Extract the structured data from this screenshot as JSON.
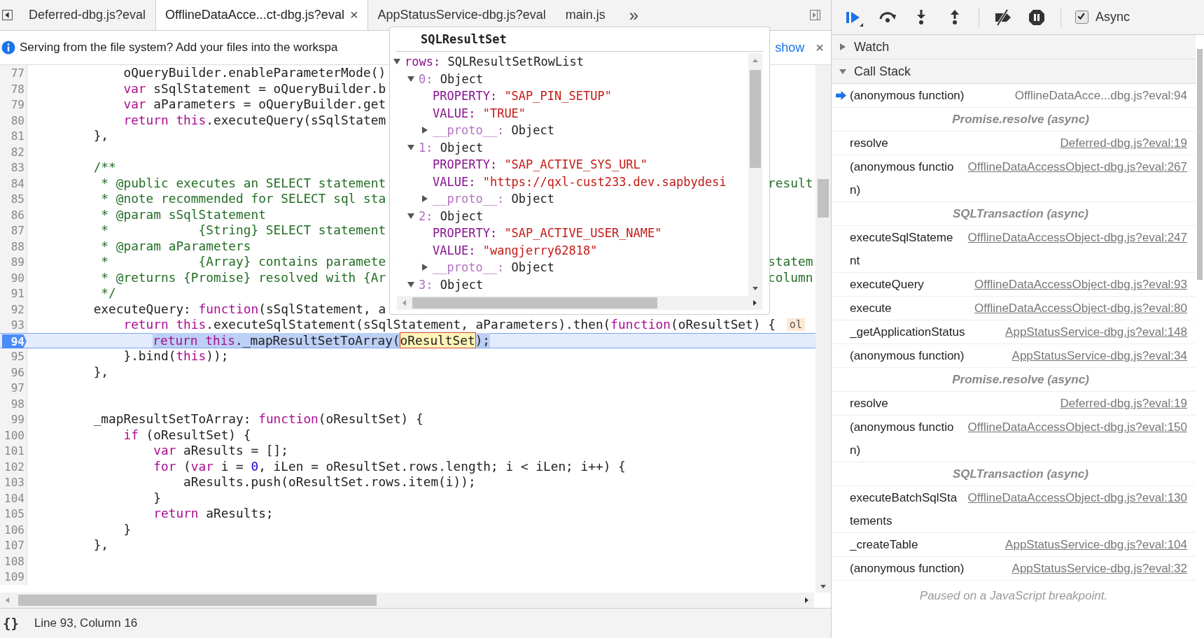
{
  "tabs": {
    "items": [
      {
        "label": "Deferred-dbg.js?eval",
        "selected": false
      },
      {
        "label": "OfflineDataAcce...ct-dbg.js?eval",
        "selected": true,
        "close": "×"
      },
      {
        "label": "AppStatusService-dbg.js?eval",
        "selected": false
      },
      {
        "label": "main.js",
        "selected": false
      }
    ],
    "overflow": "»"
  },
  "infobar": {
    "message": "Serving from the file system? Add your files into the workspa",
    "link": "show",
    "close": "×"
  },
  "editor": {
    "lines": [
      {
        "number": "77",
        "current": false,
        "tokens": [
          {
            "text": "            oQueryBuilder.enableParameterMode()",
            "kind": "plain"
          }
        ]
      },
      {
        "number": "78",
        "current": false,
        "tokens": [
          {
            "text": "            var",
            "kind": "keyword"
          },
          {
            "text": " sSqlStatement = oQueryBuilder.b",
            "kind": "plain"
          }
        ]
      },
      {
        "number": "79",
        "current": false,
        "tokens": [
          {
            "text": "            var",
            "kind": "keyword"
          },
          {
            "text": " aParameters = oQueryBuilder.get",
            "kind": "plain"
          }
        ]
      },
      {
        "number": "80",
        "current": false,
        "tokens": [
          {
            "text": "            return this",
            "kind": "keyword"
          },
          {
            "text": ".executeQuery(sSqlStatem",
            "kind": "plain"
          }
        ]
      },
      {
        "number": "81",
        "current": false,
        "tokens": [
          {
            "text": "        },",
            "kind": "plain"
          }
        ]
      },
      {
        "number": "82",
        "current": false
      },
      {
        "number": "83",
        "current": false,
        "tokens": [
          {
            "text": "        /**",
            "kind": "comment"
          }
        ]
      },
      {
        "number": "84",
        "current": false,
        "tokens": [
          {
            "text": "         * @public executes an SELECT statement",
            "kind": "comment"
          }
        ],
        "right": [
          {
            "text": "result",
            "kind": "comment"
          }
        ]
      },
      {
        "number": "85",
        "current": false,
        "tokens": [
          {
            "text": "         * @note recommended for SELECT sql sta",
            "kind": "comment"
          }
        ]
      },
      {
        "number": "86",
        "current": false,
        "tokens": [
          {
            "text": "         * @param sSqlStatement",
            "kind": "comment"
          }
        ]
      },
      {
        "number": "87",
        "current": false,
        "tokens": [
          {
            "text": "         *            {String} SELECT statement",
            "kind": "comment"
          }
        ]
      },
      {
        "number": "88",
        "current": false,
        "tokens": [
          {
            "text": "         * @param aParameters",
            "kind": "comment"
          }
        ]
      },
      {
        "number": "89",
        "current": false,
        "tokens": [
          {
            "text": "         *            {Array} contains paramete",
            "kind": "comment"
          }
        ],
        "right": [
          {
            "text": "statem",
            "kind": "comment"
          }
        ]
      },
      {
        "number": "90",
        "current": false,
        "tokens": [
          {
            "text": "         * @returns {Promise} resolved with {Ar",
            "kind": "comment"
          }
        ],
        "right": [
          {
            "text": "column",
            "kind": "comment"
          }
        ]
      },
      {
        "number": "91",
        "current": false,
        "tokens": [
          {
            "text": "         */",
            "kind": "comment"
          }
        ]
      },
      {
        "number": "92",
        "current": false,
        "tokens": [
          {
            "text": "        executeQuery: ",
            "kind": "plain"
          },
          {
            "text": "function",
            "kind": "keyword"
          },
          {
            "text": "(sSqlStatement, a",
            "kind": "plain"
          }
        ]
      },
      {
        "number": "93",
        "current": false,
        "tokens": [
          {
            "text": "            return this",
            "kind": "keyword"
          },
          {
            "text": ".executeSqlStatement(sSqlStatement, aParameters).then(",
            "kind": "plain"
          },
          {
            "text": "function",
            "kind": "keyword"
          },
          {
            "text": "(oResultSet) {",
            "kind": "plain"
          }
        ],
        "hint": "ol"
      },
      {
        "number": "94",
        "current": true,
        "selection": [
          {
            "text": "                return this",
            "kind": "keyword"
          },
          {
            "text": "._mapResultSetToArray(",
            "kind": "plain"
          },
          {
            "text": "oResultSet",
            "kind": "highlight"
          },
          {
            "text": ");",
            "kind": "plain"
          }
        ]
      },
      {
        "number": "95",
        "current": false,
        "tokens": [
          {
            "text": "            }.bind(",
            "kind": "plain"
          },
          {
            "text": "this",
            "kind": "keyword"
          },
          {
            "text": "));",
            "kind": "plain"
          }
        ]
      },
      {
        "number": "96",
        "current": false,
        "tokens": [
          {
            "text": "        },",
            "kind": "plain"
          }
        ]
      },
      {
        "number": "97",
        "current": false
      },
      {
        "number": "98",
        "current": false
      },
      {
        "number": "99",
        "current": false,
        "tokens": [
          {
            "text": "        _mapResultSetToArray: ",
            "kind": "plain"
          },
          {
            "text": "function",
            "kind": "keyword"
          },
          {
            "text": "(oResultSet) {",
            "kind": "plain"
          }
        ]
      },
      {
        "number": "100",
        "current": false,
        "tokens": [
          {
            "text": "            if",
            "kind": "keyword"
          },
          {
            "text": " (oResultSet) {",
            "kind": "plain"
          }
        ]
      },
      {
        "number": "101",
        "current": false,
        "tokens": [
          {
            "text": "                var",
            "kind": "keyword"
          },
          {
            "text": " aResults = [];",
            "kind": "plain"
          }
        ]
      },
      {
        "number": "102",
        "current": false,
        "tokens": [
          {
            "text": "                for",
            "kind": "keyword"
          },
          {
            "text": " (",
            "kind": "plain"
          },
          {
            "text": "var",
            "kind": "keyword"
          },
          {
            "text": " i = ",
            "kind": "plain"
          },
          {
            "text": "0",
            "kind": "number"
          },
          {
            "text": ", iLen = oResultSet.rows.length; i < iLen; i++) {",
            "kind": "plain"
          }
        ]
      },
      {
        "number": "103",
        "current": false,
        "tokens": [
          {
            "text": "                    aResults.push(oResultSet.rows.item(i));",
            "kind": "plain"
          }
        ]
      },
      {
        "number": "104",
        "current": false,
        "tokens": [
          {
            "text": "                }",
            "kind": "plain"
          }
        ]
      },
      {
        "number": "105",
        "current": false,
        "tokens": [
          {
            "text": "                return",
            "kind": "keyword"
          },
          {
            "text": " aResults;",
            "kind": "plain"
          }
        ]
      },
      {
        "number": "106",
        "current": false,
        "tokens": [
          {
            "text": "            }",
            "kind": "plain"
          }
        ]
      },
      {
        "number": "107",
        "current": false,
        "tokens": [
          {
            "text": "        },",
            "kind": "plain"
          }
        ]
      },
      {
        "number": "108",
        "current": false
      },
      {
        "number": "109",
        "current": false
      }
    ]
  },
  "popover": {
    "title": "SQLResultSet",
    "tree": [
      {
        "key": {
          "text": "rows:",
          "kind": "property"
        },
        "value": {
          "text": "SQLResultSetRowList",
          "kind": "object"
        },
        "expanded": true,
        "children": [
          {
            "key": {
              "text": "0:",
              "kind": "index"
            },
            "value": {
              "text": "Object",
              "kind": "object"
            },
            "expanded": true,
            "children": [
              {
                "key": {
                  "text": "PROPERTY:",
                  "kind": "property"
                },
                "value": {
                  "text": "\"SAP_PIN_SETUP\"",
                  "kind": "string"
                }
              },
              {
                "key": {
                  "text": "VALUE:",
                  "kind": "property"
                },
                "value": {
                  "text": "\"TRUE\"",
                  "kind": "string"
                }
              },
              {
                "key": {
                  "text": "__proto__:",
                  "kind": "internal"
                },
                "value": {
                  "text": "Object",
                  "kind": "object"
                },
                "expanded": false
              }
            ]
          },
          {
            "key": {
              "text": "1:",
              "kind": "index"
            },
            "value": {
              "text": "Object",
              "kind": "object"
            },
            "expanded": true,
            "children": [
              {
                "key": {
                  "text": "PROPERTY:",
                  "kind": "property"
                },
                "value": {
                  "text": "\"SAP_ACTIVE_SYS_URL\"",
                  "kind": "string"
                }
              },
              {
                "key": {
                  "text": "VALUE:",
                  "kind": "property"
                },
                "value": {
                  "text": "\"https://qxl-cust233.dev.sapbydesi",
                  "kind": "string"
                }
              },
              {
                "key": {
                  "text": "__proto__:",
                  "kind": "internal"
                },
                "value": {
                  "text": "Object",
                  "kind": "object"
                },
                "expanded": false
              }
            ]
          },
          {
            "key": {
              "text": "2:",
              "kind": "index"
            },
            "value": {
              "text": "Object",
              "kind": "object"
            },
            "expanded": true,
            "children": [
              {
                "key": {
                  "text": "PROPERTY:",
                  "kind": "property"
                },
                "value": {
                  "text": "\"SAP_ACTIVE_USER_NAME\"",
                  "kind": "string"
                }
              },
              {
                "key": {
                  "text": "VALUE:",
                  "kind": "property"
                },
                "value": {
                  "text": "\"wangjerry62818\"",
                  "kind": "string"
                }
              },
              {
                "key": {
                  "text": "__proto__:",
                  "kind": "internal"
                },
                "value": {
                  "text": "Object",
                  "kind": "object"
                },
                "expanded": false
              }
            ]
          },
          {
            "key": {
              "text": "3:",
              "kind": "index"
            },
            "value": {
              "text": "Object",
              "kind": "object"
            },
            "expanded": true
          }
        ]
      }
    ]
  },
  "status_bar": {
    "format": "{}",
    "position": "Line 93, Column 16"
  },
  "debugger": {
    "async": {
      "label": "Async",
      "checked": true
    },
    "watch": {
      "title": "Watch",
      "expanded": false
    },
    "call_stack": {
      "title": "Call Stack",
      "expanded": true,
      "frames": [
        {
          "kind": "frame",
          "name": "(anonymous function)",
          "location": "OfflineDataAcce...dbg.js?eval:94",
          "current": true
        },
        {
          "kind": "async",
          "name": "Promise.resolve (async)"
        },
        {
          "kind": "frame",
          "name": "resolve",
          "location": "Deferred-dbg.js?eval:19",
          "current": false
        },
        {
          "kind": "frame",
          "name": "(anonymous function)",
          "location": "OfflineDataAccessObject-dbg.js?eval:267",
          "current": false
        },
        {
          "kind": "async",
          "name": "SQLTransaction (async)"
        },
        {
          "kind": "frame",
          "name": "executeSqlStatement",
          "location": "OfflineDataAccessObject-dbg.js?eval:247",
          "current": false
        },
        {
          "kind": "frame",
          "name": "executeQuery",
          "location": "OfflineDataAccessObject-dbg.js?eval:93",
          "current": false
        },
        {
          "kind": "frame",
          "name": "execute",
          "location": "OfflineDataAccessObject-dbg.js?eval:80",
          "current": false
        },
        {
          "kind": "frame",
          "name": "_getApplicationStatus",
          "location": "AppStatusService-dbg.js?eval:148",
          "current": false
        },
        {
          "kind": "frame",
          "name": "(anonymous function)",
          "location": "AppStatusService-dbg.js?eval:34",
          "current": false
        },
        {
          "kind": "async",
          "name": "Promise.resolve (async)"
        },
        {
          "kind": "frame",
          "name": "resolve",
          "location": "Deferred-dbg.js?eval:19",
          "current": false
        },
        {
          "kind": "frame",
          "name": "(anonymous function)",
          "location": "OfflineDataAccessObject-dbg.js?eval:150",
          "current": false
        },
        {
          "kind": "async",
          "name": "SQLTransaction (async)"
        },
        {
          "kind": "frame",
          "name": "executeBatchSqlStatements",
          "location": "OfflineDataAccessObject-dbg.js?eval:130",
          "current": false
        },
        {
          "kind": "frame",
          "name": "_createTable",
          "location": "AppStatusService-dbg.js?eval:104",
          "current": false
        },
        {
          "kind": "frame",
          "name": "(anonymous function)",
          "location": "AppStatusService-dbg.js?eval:32",
          "current": false
        }
      ]
    },
    "footer": "Paused on a JavaScript breakpoint."
  }
}
